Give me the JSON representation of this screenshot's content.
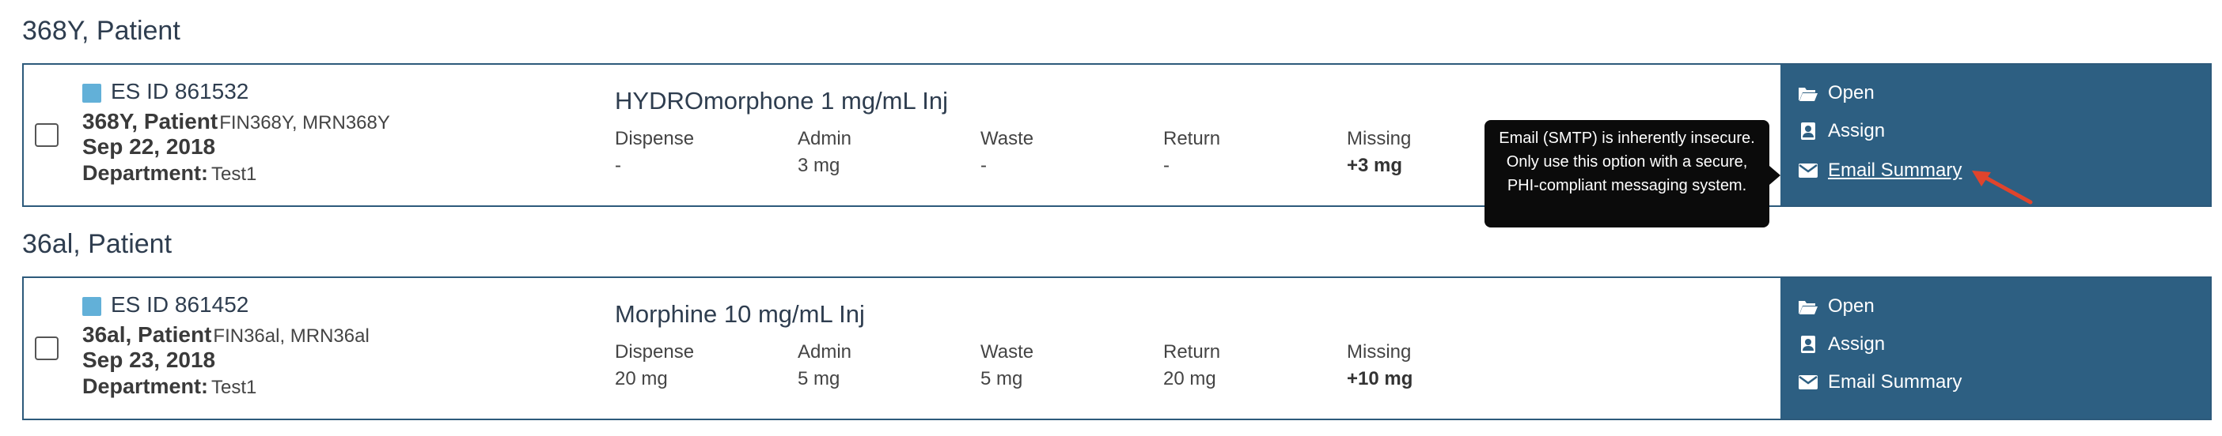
{
  "patients": [
    {
      "group_title": "368Y, Patient",
      "es_id": "ES ID 861532",
      "name": "368Y, Patient",
      "ids": "FIN368Y, MRN368Y",
      "date": "Sep 22, 2018",
      "department_label": "Department:",
      "department": "Test1",
      "medication": "HYDROmorphone 1 mg/mL Inj",
      "columns": [
        {
          "label": "Dispense",
          "value": "-"
        },
        {
          "label": "Admin",
          "value": "3 mg"
        },
        {
          "label": "Waste",
          "value": "-"
        },
        {
          "label": "Return",
          "value": "-"
        },
        {
          "label": "Missing",
          "value": "+3 mg"
        }
      ],
      "actions": {
        "open": "Open",
        "assign": "Assign",
        "email": "Email Summary"
      }
    },
    {
      "group_title": "36al, Patient",
      "es_id": "ES ID 861452",
      "name": "36al, Patient",
      "ids": "FIN36al, MRN36al",
      "date": "Sep 23, 2018",
      "department_label": "Department:",
      "department": "Test1",
      "medication": "Morphine 10 mg/mL Inj",
      "columns": [
        {
          "label": "Dispense",
          "value": "20 mg"
        },
        {
          "label": "Admin",
          "value": "5 mg"
        },
        {
          "label": "Waste",
          "value": "5 mg"
        },
        {
          "label": "Return",
          "value": "20 mg"
        },
        {
          "label": "Missing",
          "value": "+10 mg"
        }
      ],
      "actions": {
        "open": "Open",
        "assign": "Assign",
        "email": "Email Summary"
      }
    }
  ],
  "tooltip": {
    "text": "Email (SMTP) is inherently insecure. Only use this option with a secure, PHI-compliant messaging system."
  },
  "icons": {
    "open": "folder-open-icon",
    "assign": "user-badge-icon",
    "email": "envelope-icon",
    "annotation": "red-arrow-icon"
  },
  "colors": {
    "action_panel": "#2d5f82",
    "card_border": "#2d5a7b",
    "es_badge": "#62b0d8",
    "annotation_arrow": "#e0442c"
  }
}
